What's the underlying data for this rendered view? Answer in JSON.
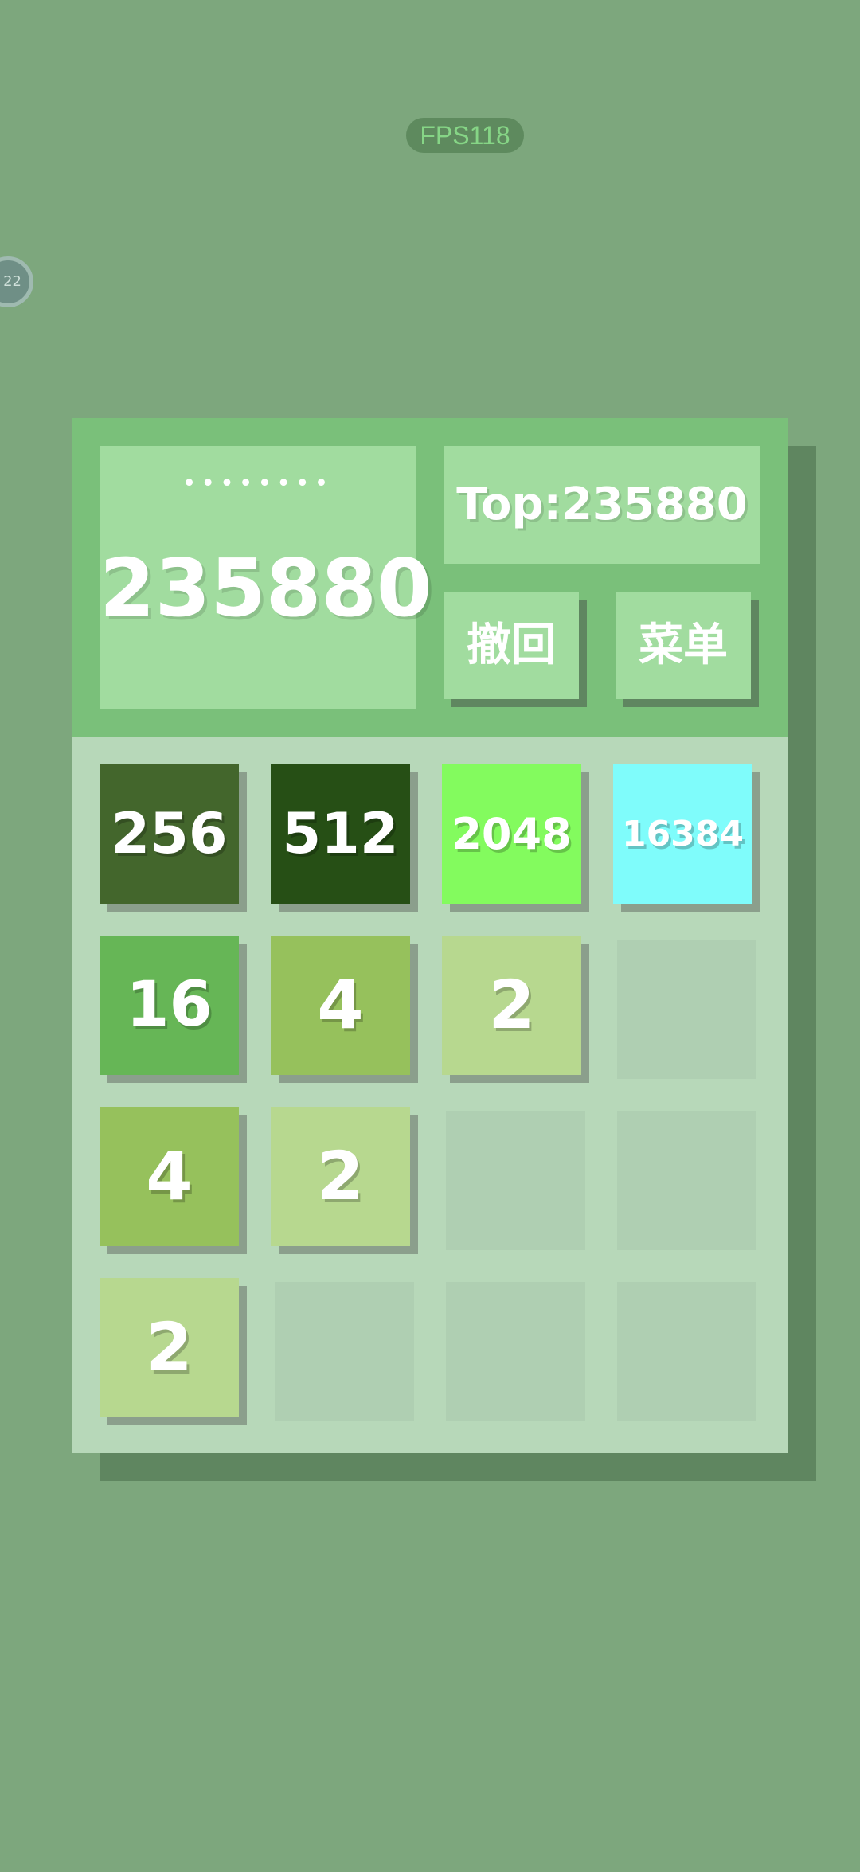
{
  "status": {
    "fps_label": "FPS118",
    "float_ball_text": "22"
  },
  "header": {
    "hidden_label": "••••••••",
    "score": "235880",
    "top_label": "Top:235880",
    "undo_label": "撤回",
    "menu_label": "菜单"
  },
  "grid": {
    "rows": [
      [
        "256",
        "512",
        "2048",
        "16384"
      ],
      [
        "16",
        "4",
        "2",
        ""
      ],
      [
        "4",
        "2",
        "",
        ""
      ],
      [
        "2",
        "",
        "",
        ""
      ]
    ]
  },
  "tile_colors": {
    "2": "#b7d88f",
    "4": "#96c15c",
    "16": "#66b656",
    "256": "#43662c",
    "512": "#264f15",
    "2048": "#83fb5e",
    "16384": "#7ffcfb",
    "empty": "#afcfb2",
    "board": "#b7d8b9",
    "header": "#7ac07a",
    "panel": "#a1dc9f",
    "background": "#7da77d"
  }
}
